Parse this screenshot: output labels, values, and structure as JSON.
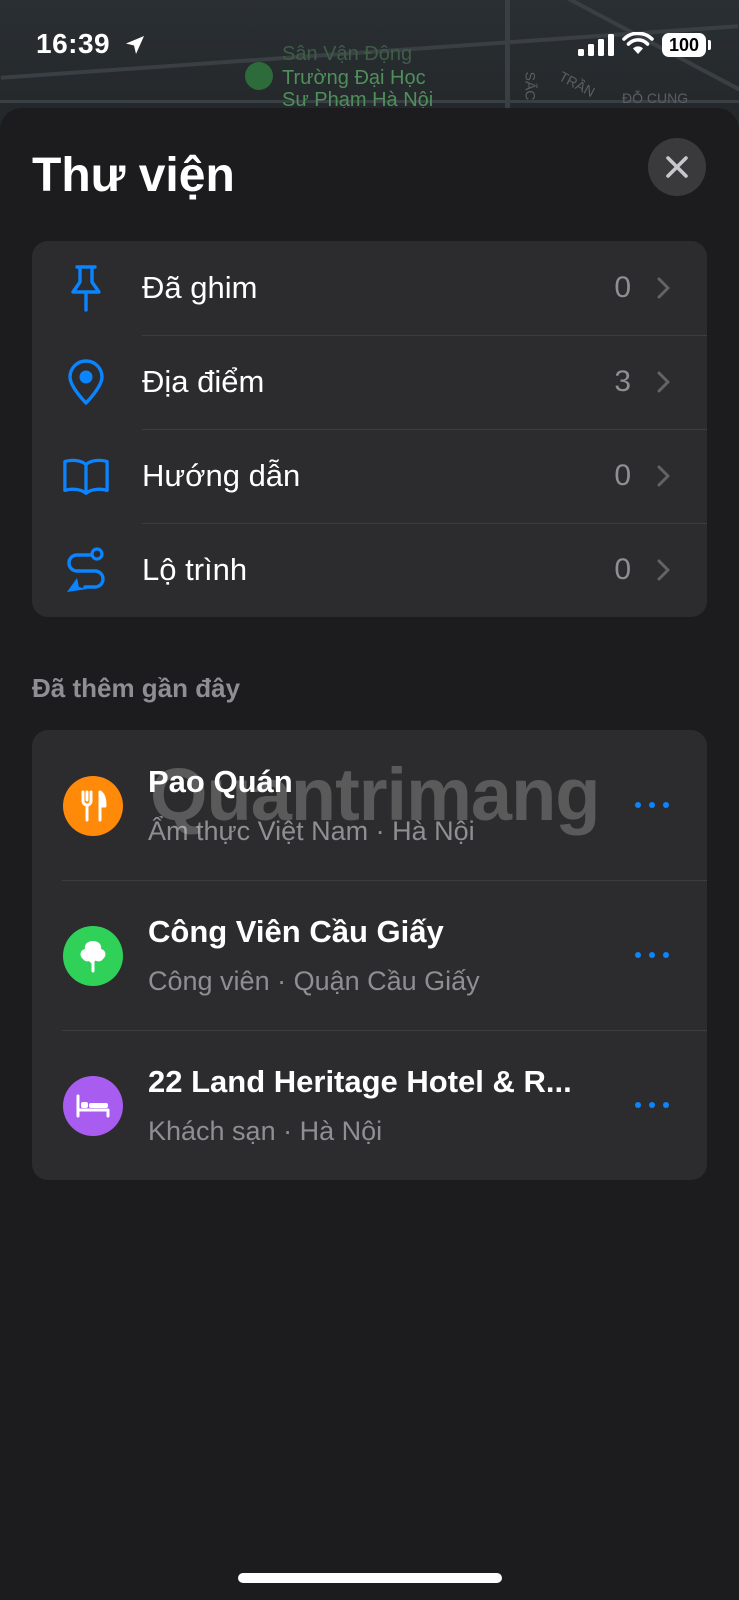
{
  "status_bar": {
    "time": "16:39",
    "battery": "100"
  },
  "map": {
    "labels": [
      "Sân Vận Động",
      "Trường Đại Học",
      "Sư Phạm Hà Nội"
    ],
    "streets": [
      "SẮC",
      "TRẦN",
      "ĐỖ CUNG"
    ]
  },
  "header": {
    "title": "Thư viện"
  },
  "library": {
    "items": [
      {
        "label": "Đã ghim",
        "count": "0",
        "icon": "pin-icon"
      },
      {
        "label": "Địa điểm",
        "count": "3",
        "icon": "location-pin-icon"
      },
      {
        "label": "Hướng dẫn",
        "count": "0",
        "icon": "book-icon"
      },
      {
        "label": "Lộ trình",
        "count": "0",
        "icon": "route-icon"
      }
    ]
  },
  "recent": {
    "section_label": "Đã thêm gần đây",
    "items": [
      {
        "name": "Pao Quán",
        "subtitle": "Ẩm thực Việt Nam · Hà Nội",
        "icon": "fork-knife-icon",
        "color": "#ff8a0a"
      },
      {
        "name": "Công Viên Cầu Giấy",
        "subtitle": "Công viên · Quận Cầu Giấy",
        "icon": "tree-icon",
        "color": "#30d158"
      },
      {
        "name": "22 Land Heritage Hotel & R...",
        "subtitle": "Khách sạn · Hà Nội",
        "icon": "bed-icon",
        "color": "#a95cf0"
      }
    ]
  },
  "watermark": "Quantrimang",
  "colors": {
    "accent": "#0a84ff",
    "background": "#1c1c1e",
    "card": "#2c2c2e",
    "secondary_text": "#8e8e93"
  }
}
